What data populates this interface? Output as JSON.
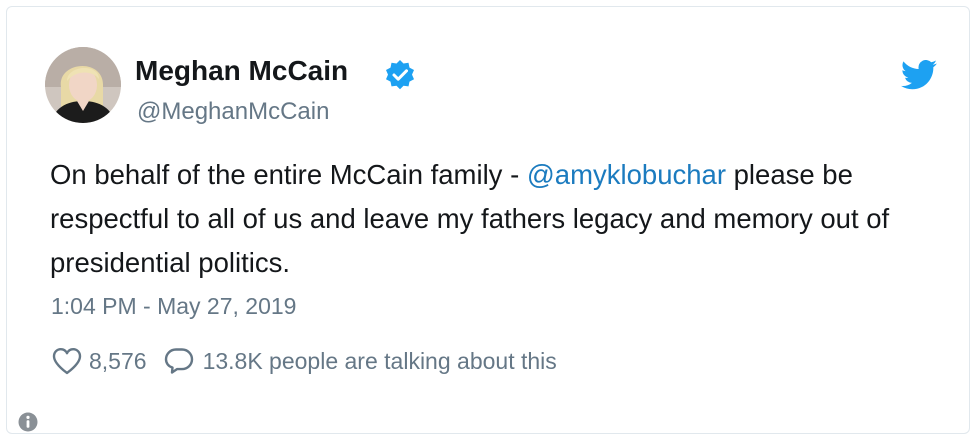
{
  "author": {
    "name": "Meghan McCain",
    "handle": "@MeghanMcCain",
    "verified": true,
    "avatar": "profile-photo"
  },
  "tweet": {
    "text_before": "On behalf of the entire McCain family - ",
    "mention": "@amyklobuchar",
    "text_after": " please be respectful to all of us and leave my fathers legacy and memory out of presidential politics.",
    "timestamp": "1:04 PM - May 27, 2019"
  },
  "engagement": {
    "likes": "8,576",
    "conversation": "13.8K people are talking about this"
  },
  "icons": {
    "brand": "twitter-bird-icon",
    "verified": "verified-badge-icon",
    "like": "heart-icon",
    "reply": "speech-bubble-icon",
    "info": "info-icon"
  },
  "colors": {
    "text": "#14171a",
    "secondary": "#657786",
    "mention": "#1b7bbf",
    "twitter_blue": "#1da1f2",
    "border": "#e1e8ed"
  }
}
